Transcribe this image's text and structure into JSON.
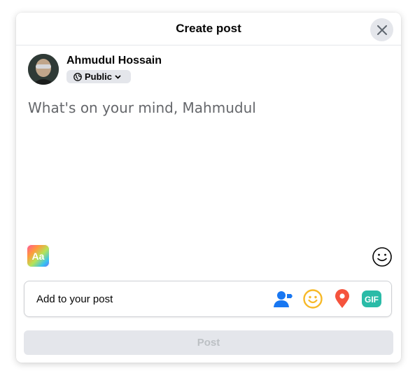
{
  "header": {
    "title": "Create post",
    "close_icon": "close-icon"
  },
  "user": {
    "name": "Ahmudul Hossain",
    "privacy_label": "Public",
    "privacy_icon": "globe-icon"
  },
  "composer": {
    "placeholder": "What's on your mind, Mahmudul"
  },
  "tools": {
    "text_style_label": "Aa",
    "emoji_icon": "smiley-icon"
  },
  "add_to_post": {
    "label": "Add to your post",
    "icons": [
      "tag-people-icon",
      "feeling-icon",
      "location-icon",
      "gif-icon"
    ],
    "gif_label": "GIF",
    "colors": {
      "tag": "#1877f2",
      "feeling": "#f7b928",
      "location": "#f5533d",
      "gif": "#2abba7"
    }
  },
  "footer": {
    "post_label": "Post"
  }
}
